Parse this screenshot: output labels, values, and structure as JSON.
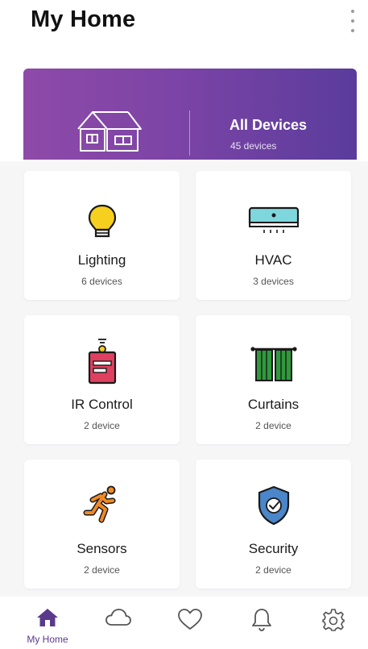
{
  "header": {
    "title": "My Home"
  },
  "banner": {
    "title": "All Devices",
    "count": "45 devices"
  },
  "cards": [
    {
      "name": "Lighting",
      "count": "6 devices",
      "icon": "bulb-icon"
    },
    {
      "name": "HVAC",
      "count": "3 devices",
      "icon": "air-conditioner-icon"
    },
    {
      "name": "IR Control",
      "count": "2 device",
      "icon": "ir-remote-icon"
    },
    {
      "name": "Curtains",
      "count": "2 device",
      "icon": "curtains-icon"
    },
    {
      "name": "Sensors",
      "count": "2 device",
      "icon": "running-person-icon"
    },
    {
      "name": "Security",
      "count": "2 device",
      "icon": "shield-check-icon"
    }
  ],
  "nav": {
    "active_label": "My Home",
    "items": [
      "home-icon",
      "cloud-icon",
      "heart-icon",
      "bell-icon",
      "gear-icon"
    ]
  },
  "colors": {
    "accent": "#5b3a8c",
    "banner_start": "#8e4aa8",
    "banner_end": "#5a3c9c"
  }
}
